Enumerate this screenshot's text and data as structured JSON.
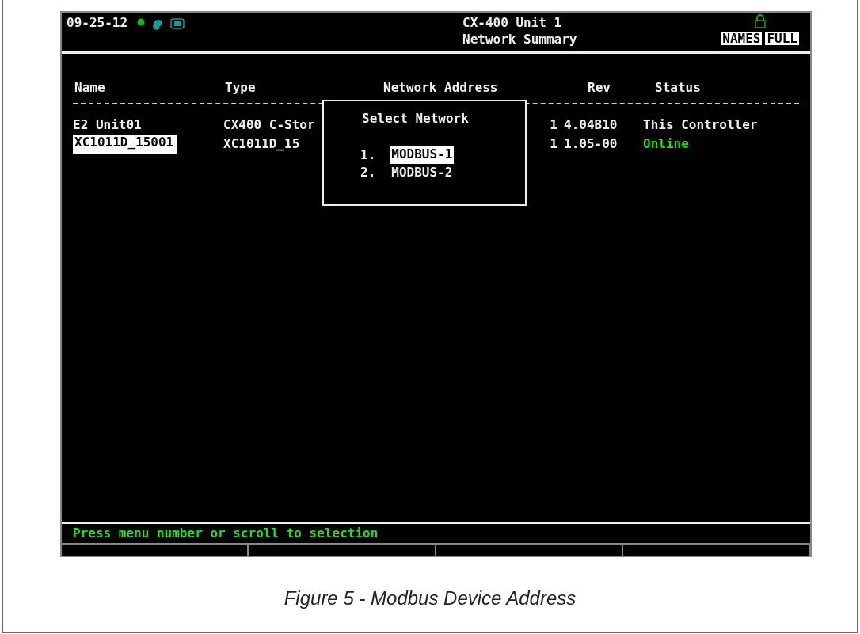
{
  "header": {
    "date": "09-25-12",
    "title": "CX-400 Unit 1",
    "subtitle": "Network Summary",
    "badges": [
      "NAMES",
      "FULL"
    ]
  },
  "table": {
    "columns": [
      "Name",
      "Type",
      "Network Address",
      "Rev",
      "Status"
    ],
    "rows": [
      {
        "name": "E2 Unit01",
        "type": "CX400 C-Stor",
        "address": "1",
        "rev": "4.04B10",
        "status": "This Controller",
        "color": "#f0f0f0",
        "selected": false
      },
      {
        "name": "XC1011D_15001",
        "type": "XC1011D_15",
        "address": "1",
        "rev": "1.05-00",
        "status": "Online",
        "color": "#22dd22",
        "selected": true
      }
    ]
  },
  "dialog": {
    "title": "Select Network",
    "options": [
      {
        "number": "1.",
        "label": "MODBUS-1",
        "selected": true
      },
      {
        "number": "2.",
        "label": "MODBUS-2",
        "selected": false
      }
    ]
  },
  "status_bar": "Press menu number or scroll to selection",
  "caption": "Figure 5 - Modbus Device Address"
}
